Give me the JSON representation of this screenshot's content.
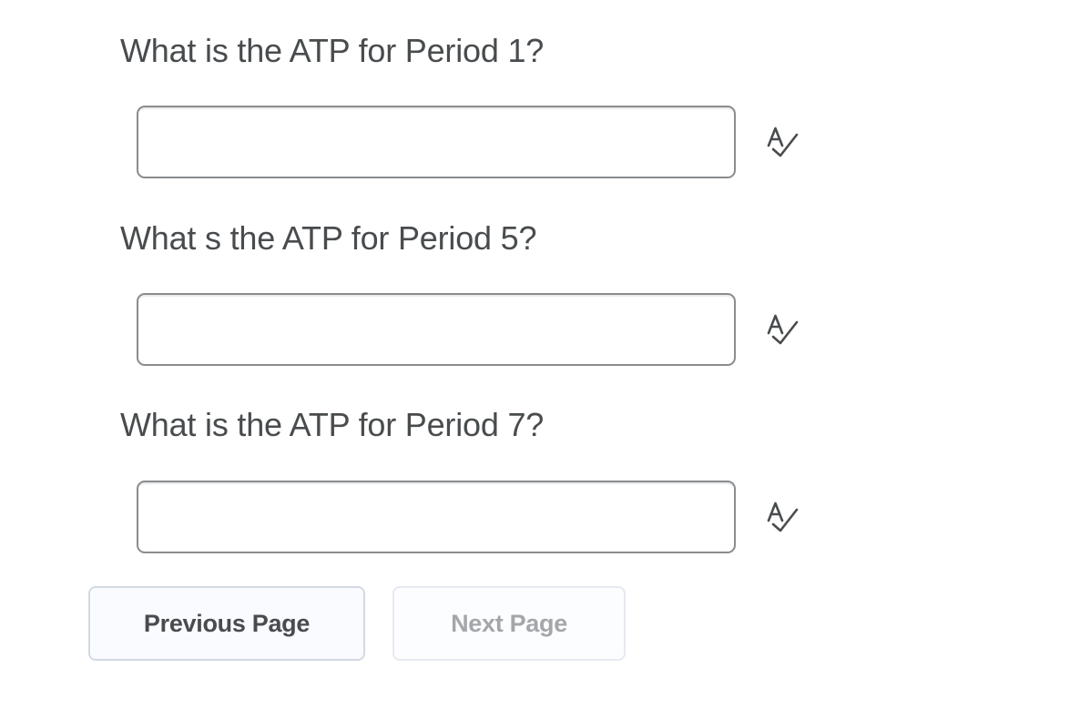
{
  "questions": [
    {
      "text": "What is the ATP for Period 1?",
      "answer_value": ""
    },
    {
      "text": "What s the ATP for Period 5?",
      "answer_value": ""
    },
    {
      "text": "What is the ATP for Period 7?",
      "answer_value": ""
    }
  ],
  "spell_check_icon": "spell-check-icon",
  "navigation": {
    "previous_label": "Previous Page",
    "next_label": "Next Page",
    "next_disabled": true
  },
  "colors": {
    "text": "#494c4e",
    "input_border": "#8a8c8e",
    "button_border": "#d3d9e3",
    "disabled_text": "#a4a7aa"
  }
}
